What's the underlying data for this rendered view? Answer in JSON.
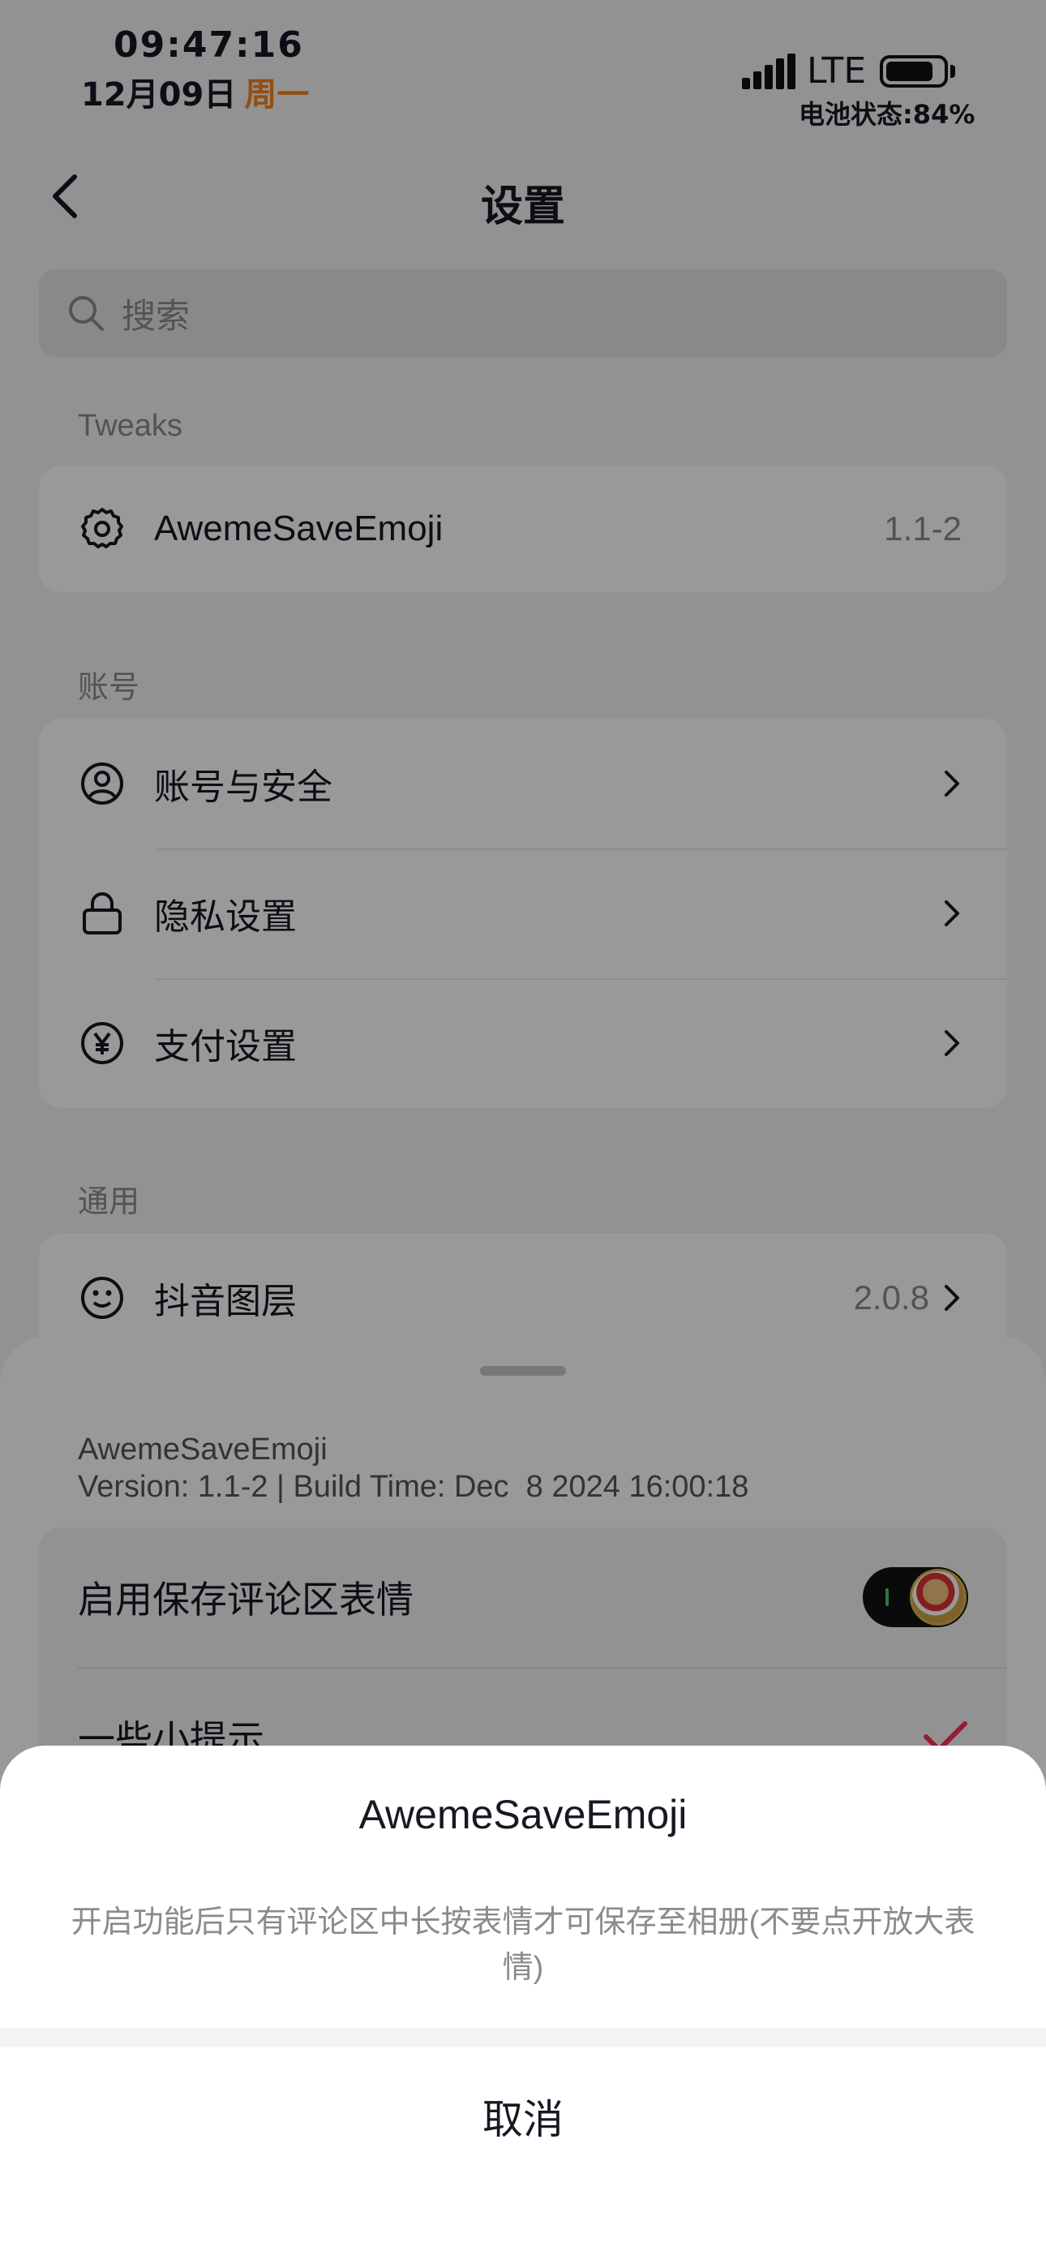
{
  "status_bar": {
    "time": "09:47:16",
    "date": "12月09日",
    "weekday": "周一",
    "network": "LTE",
    "battery_label": "电池状态:84%",
    "battery_level": 0.84
  },
  "nav": {
    "title": "设置"
  },
  "search": {
    "placeholder": "搜索"
  },
  "sections": [
    {
      "title": "Tweaks",
      "items": [
        {
          "label": "AwemeSaveEmoji",
          "value": "1.1-2",
          "icon": "gear-icon"
        }
      ]
    },
    {
      "title": "账号",
      "items": [
        {
          "label": "账号与安全",
          "icon": "user-circle-icon"
        },
        {
          "label": "隐私设置",
          "icon": "lock-icon"
        },
        {
          "label": "支付设置",
          "icon": "yen-icon"
        }
      ]
    },
    {
      "title": "通用",
      "items": [
        {
          "label": "抖音图层",
          "value": "2.0.8",
          "icon": "smiley-icon"
        }
      ]
    }
  ],
  "tweak_sheet": {
    "name": "AwemeSaveEmoji",
    "version_line": "Version: 1.1-2 | Build Time: Dec  8 2024 16:00:18",
    "options": [
      {
        "label": "启用保存评论区表情",
        "control": "toggle",
        "on": true
      },
      {
        "label": "一些小提示",
        "control": "checkmark"
      }
    ]
  },
  "alert": {
    "title": "AwemeSaveEmoji",
    "message": "开启功能后只有评论区中长按表情才可保存至相册(不要点开放大表情)",
    "cancel_label": "取消"
  },
  "colors": {
    "accent_orange": "#f58220",
    "check_red": "#fe2c55",
    "toggle_bg": "#111111"
  }
}
